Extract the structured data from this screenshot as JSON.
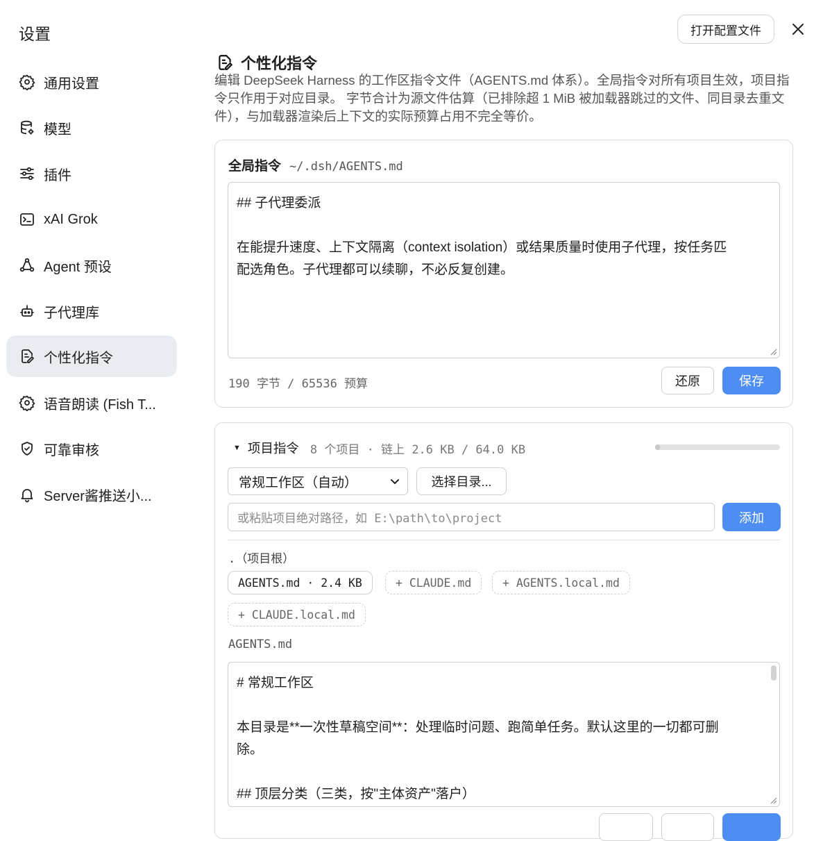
{
  "sidebar": {
    "title": "设置",
    "items": [
      {
        "label": "通用设置",
        "icon": "gear-icon"
      },
      {
        "label": "模型",
        "icon": "database-icon"
      },
      {
        "label": "插件",
        "icon": "sliders-icon"
      },
      {
        "label": "xAI Grok",
        "icon": "terminal-icon"
      },
      {
        "label": "Agent 预设",
        "icon": "network-icon"
      },
      {
        "label": "子代理库",
        "icon": "robot-icon"
      },
      {
        "label": "个性化指令",
        "icon": "edit-doc-icon",
        "active": true
      },
      {
        "label": "语音朗读 (Fish T...",
        "icon": "gear-icon"
      },
      {
        "label": "可靠审核",
        "icon": "shield-icon"
      },
      {
        "label": "Server酱推送小...",
        "icon": "bell-icon"
      }
    ]
  },
  "header": {
    "open_config_label": "打开配置文件",
    "close_icon": "close-icon"
  },
  "main": {
    "title": "个性化指令",
    "description": "编辑 DeepSeek Harness 的工作区指令文件（AGENTS.md 体系）。全局指令对所有项目生效，项目指令只作用于对应目录。 字节合计为源文件估算（已排除超 1 MiB 被加载器跳过的文件、同目录去重文件），与加载器渲染后上下文的实际预算占用不完全等价。"
  },
  "global": {
    "title": "全局指令",
    "path": "~/.dsh/AGENTS.md",
    "content_lines": [
      "## 子代理委派",
      "",
      "在能提升速度、上下文隔离（context isolation）或结果质量时使用子代理，按任务匹",
      "配选角色。子代理都可以续聊，不必反复创建。"
    ],
    "bytes_text": "190 字节 / 65536 预算",
    "bytes_used": 190,
    "bytes_budget": 65536,
    "restore_label": "还原",
    "save_label": "保存"
  },
  "project": {
    "title": "项目指令",
    "meta": "8 个项目 · 链上 2.6 KB / 64.0 KB",
    "usage_fraction": 0.04,
    "select_value": "常规工作区（自动）",
    "choose_dir_label": "选择目录...",
    "path_placeholder": "或粘贴项目绝对路径，如 E:\\path\\to\\project",
    "add_label": "添加",
    "root_label": ".（项目根）",
    "chips": [
      {
        "label": "AGENTS.md · 2.4 KB",
        "style": "solid"
      },
      {
        "label": "+ CLAUDE.md",
        "style": "dashed"
      },
      {
        "label": "+ AGENTS.local.md",
        "style": "dashed"
      },
      {
        "label": "+ CLAUDE.local.md",
        "style": "dashed"
      }
    ],
    "file_label": "AGENTS.md",
    "content_lines": [
      "# 常规工作区",
      "",
      "本目录是**一次性草稿空间**：处理临时问题、跑简单任务。默认这里的一切都可删",
      "除。",
      "",
      "## 顶层分类（三类，按\"主体资产\"落户）"
    ]
  },
  "colors": {
    "accent": "#4e8ef3",
    "active_nav_bg": "#e9edf2",
    "border": "#dcdcdc"
  }
}
